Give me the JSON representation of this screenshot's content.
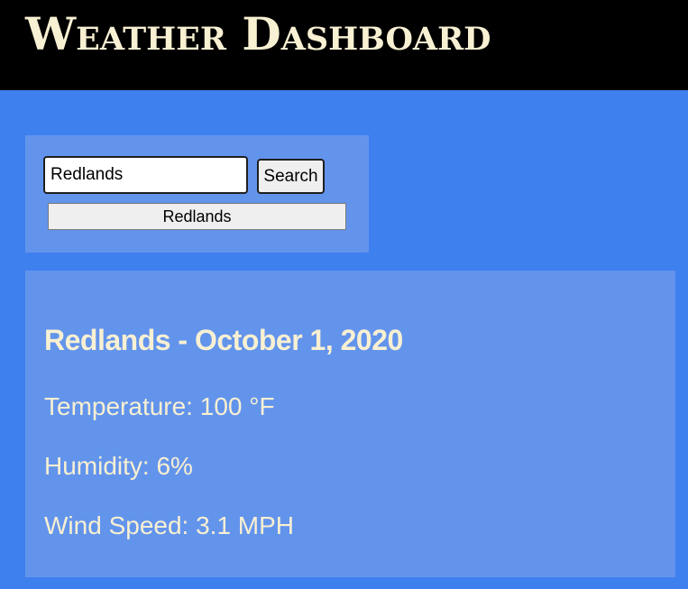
{
  "header": {
    "title": "Weather Dashboard"
  },
  "search": {
    "input_value": "Redlands",
    "button_label": "Search",
    "history": [
      "Redlands"
    ]
  },
  "current": {
    "heading": "Redlands - October 1, 2020",
    "temperature": "Temperature: 100 °F",
    "humidity": "Humidity: 6%",
    "wind_speed": "Wind Speed: 3.1 MPH"
  },
  "colors": {
    "page_background": "#3f80ef",
    "panel_background": "#6394ec",
    "header_background": "#000000",
    "header_text": "#f8f0d2",
    "panel_text": "#f8f0d2"
  }
}
